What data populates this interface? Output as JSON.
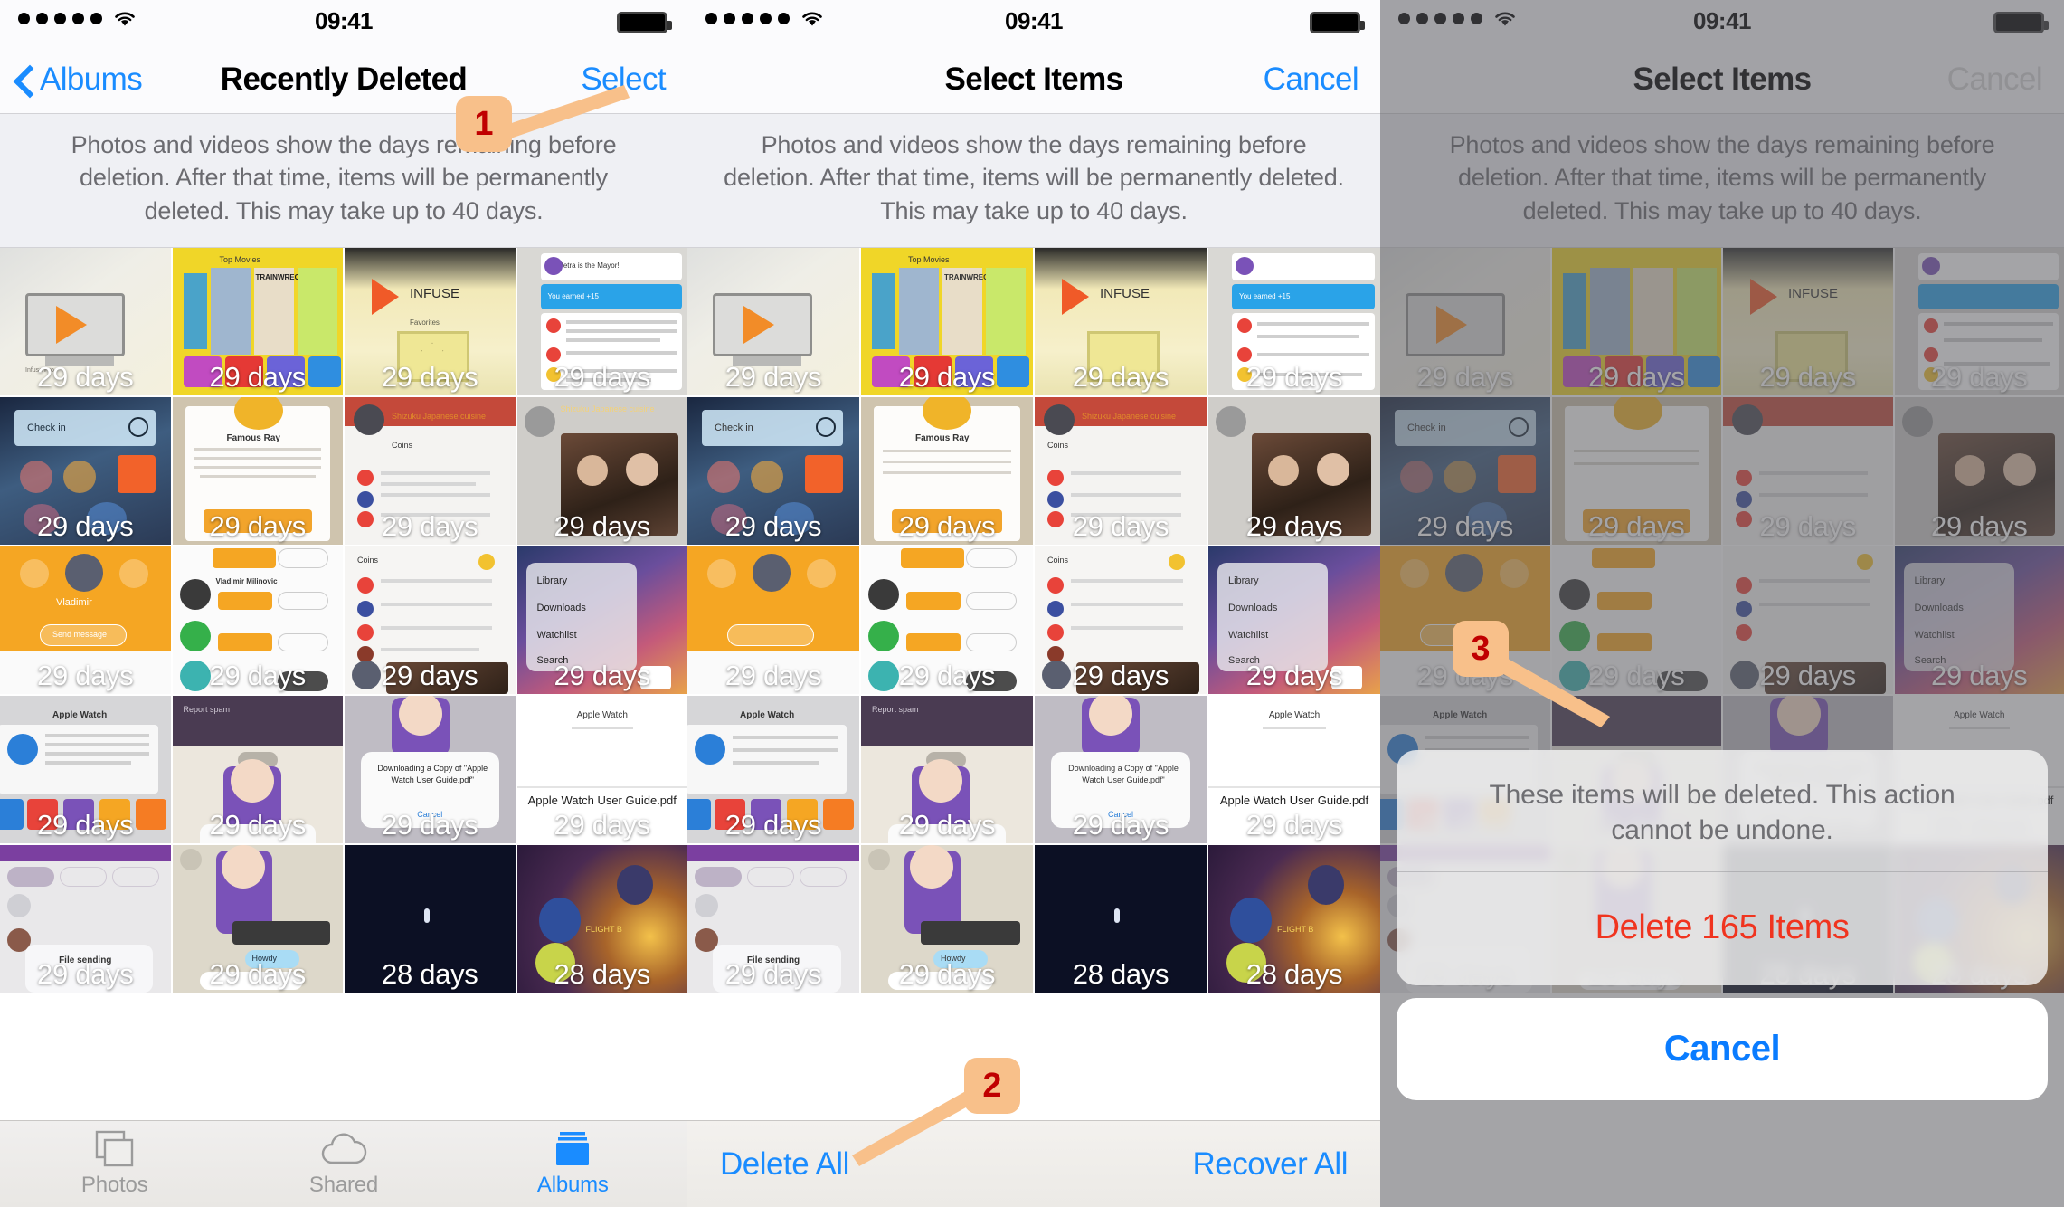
{
  "status_bar": {
    "time": "09:41",
    "signal_dots": 5,
    "wifi_icon": "wifi-icon",
    "battery_icon": "battery-full-icon"
  },
  "panels": [
    {
      "id": "recently-deleted",
      "nav": {
        "back_label": "Albums",
        "title": "Recently Deleted",
        "right_label": "Select",
        "right_color": "#1a8cff"
      },
      "description": "Photos and videos show the days remaining before deletion. After that time, items will be permanently deleted. This may take up to 40 days.",
      "bottom_type": "tabbar",
      "tabs": [
        {
          "label": "Photos",
          "icon": "photos-icon",
          "active": false
        },
        {
          "label": "Shared",
          "icon": "cloud-icon",
          "active": false
        },
        {
          "label": "Albums",
          "icon": "albums-icon",
          "active": true
        }
      ],
      "dimmed": false
    },
    {
      "id": "select-items",
      "nav": {
        "back_label": "",
        "title": "Select Items",
        "right_label": "Cancel",
        "right_color": "#1a8cff"
      },
      "description": "Photos and videos show the days remaining before deletion. After that time, items will be permanently deleted. This may take up to 40 days.",
      "bottom_type": "actionbar",
      "actions": [
        {
          "label": "Delete All",
          "align": "left"
        },
        {
          "label": "Recover All",
          "align": "right"
        }
      ],
      "dimmed": false
    },
    {
      "id": "confirm-delete",
      "nav": {
        "back_label": "",
        "title": "Select Items",
        "right_label": "Cancel",
        "right_color": "#d4d4d6"
      },
      "description": "Photos and videos show the days remaining before deletion. After that time, items will be permanently deleted. This may take up to 40 days.",
      "bottom_type": "sheet",
      "dimmed": true,
      "action_sheet": {
        "message": "These items will be deleted. This action cannot be undone.",
        "destructive_label": "Delete 165 Items",
        "cancel_label": "Cancel"
      }
    }
  ],
  "grid": {
    "columns": 4,
    "rows": 5,
    "day_labels": [
      [
        "29 days",
        "29 days",
        "29 days",
        "29 days"
      ],
      [
        "29 days",
        "29 days",
        "29 days",
        "29 days"
      ],
      [
        "29 days",
        "29 days",
        "29 days",
        "29 days"
      ],
      [
        "29 days",
        "29 days",
        "29 days",
        "29 days"
      ],
      [
        "29 days",
        "29 days",
        "28 days",
        "28 days"
      ]
    ],
    "thumbnail_texts": {
      "r1c1": "Infuse Pro",
      "r1c2": "Top Movies",
      "r1c2b": "TRAINWRECK",
      "r1c3": "INFUSE",
      "r1c3b": "Favorites",
      "r1c4": "Petra is the Mayor!",
      "r1c4b": "You earned   +15",
      "r2c1": "Check in",
      "r2c2": "Famous Ray",
      "r2c3": "Shizuku Japanese cuisine",
      "r2c3b": "Coins",
      "r2c4": "Shizuku Japanese cuisine",
      "r3c1": "Vladimir",
      "r3c1b": "Send message",
      "r3c2": "Vladimir Milinovic",
      "r3c3": "Coins",
      "r3c4a": "Library",
      "r3c4b": "Downloads",
      "r3c4c": "Watchlist",
      "r3c4d": "Search",
      "r4c1": "Apple Watch",
      "r4c2": "Report spam",
      "r4c3": "Downloading a Copy of \"Apple Watch User Guide.pdf\"",
      "r4c3b": "Cancel",
      "r4c4": "Apple Watch User Guide.pdf",
      "r5c1": "File sending",
      "r5c2": "Howdy",
      "r5c4": "FLIGHT B"
    }
  },
  "callouts": [
    {
      "number": "1",
      "target": "Select button (panel 1)"
    },
    {
      "number": "2",
      "target": "Delete All button (panel 2)"
    },
    {
      "number": "3",
      "target": "Delete 165 Items (panel 3)"
    }
  ],
  "colors": {
    "accent_blue": "#1a8cff",
    "destructive_red": "#f0341f",
    "badge_bg": "#f8c08a",
    "badge_text": "#c00000",
    "desc_bg": "#eff0f4"
  }
}
